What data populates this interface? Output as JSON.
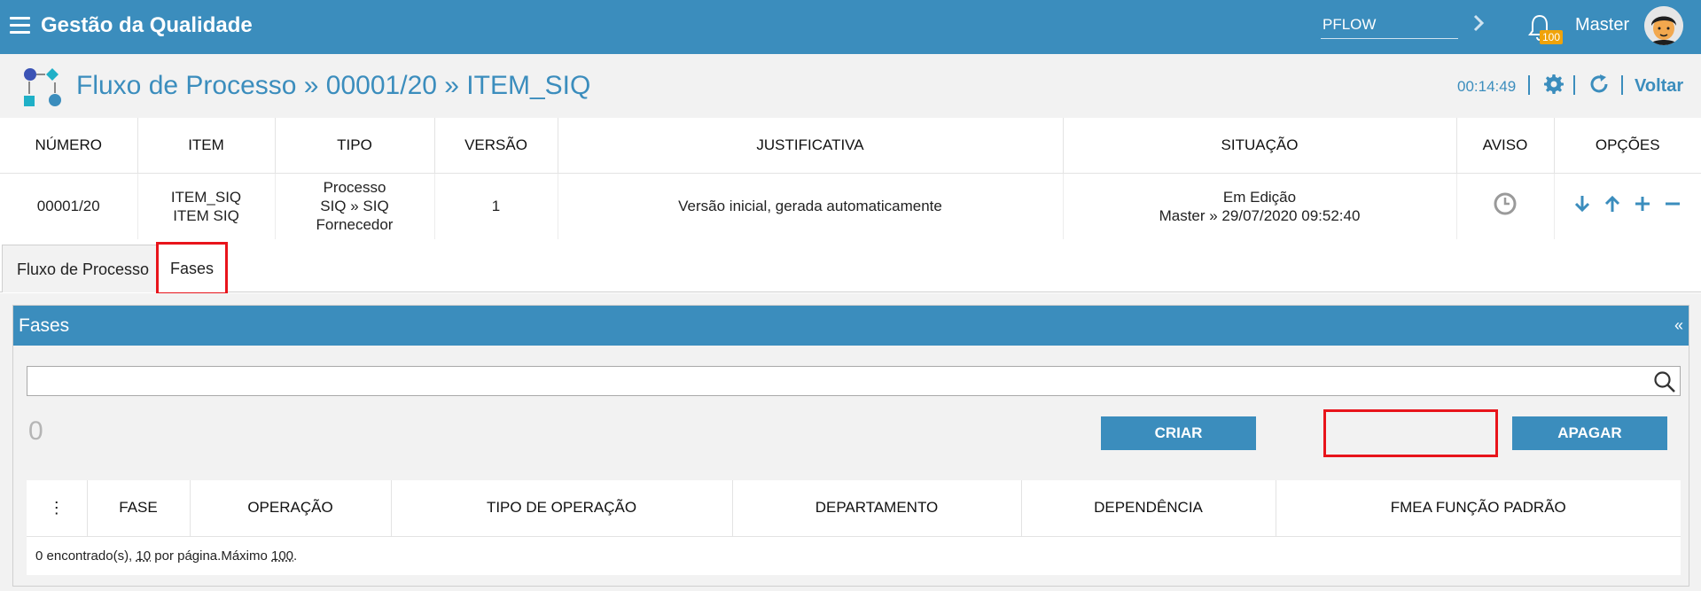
{
  "app": {
    "title": "Gestão da Qualidade",
    "module_value": "PFLOW",
    "notifications": "100",
    "user": "Master"
  },
  "header": {
    "title": "Fluxo de Processo » 00001/20 » ITEM_SIQ",
    "timer": "00:14:49",
    "back": "Voltar"
  },
  "info": {
    "columns": [
      "NÚMERO",
      "ITEM",
      "TIPO",
      "VERSÃO",
      "JUSTIFICATIVA",
      "SITUAÇÃO",
      "AVISO",
      "OPÇÕES"
    ],
    "row": {
      "numero": "00001/20",
      "item": [
        "ITEM_SIQ",
        "ITEM SIQ"
      ],
      "tipo": [
        "Processo",
        "SIQ » SIQ",
        "Fornecedor"
      ],
      "versao": "1",
      "justificativa": "Versão inicial, gerada automaticamente",
      "situacao": [
        "Em Edição",
        "Master » 29/07/2020 09:52:40"
      ]
    }
  },
  "tabs": [
    "Fluxo de Processo",
    "Fases"
  ],
  "panel": {
    "title": "Fases",
    "collapse": "«",
    "search_value": "",
    "count": "0",
    "create": "CRIAR",
    "delete": "APAGAR",
    "columns": [
      "⋮",
      "FASE",
      "OPERAÇÃO",
      "TIPO DE OPERAÇÃO",
      "DEPARTAMENTO",
      "DEPENDÊNCIA",
      "FMEA FUNÇÃO PADRÃO"
    ],
    "footer": {
      "found": "0 encontrado(s), ",
      "per_page": "10",
      "per_page_label": " por página.Máximo ",
      "max": "100",
      "end": "."
    }
  },
  "colors": {
    "primary": "#3b8dbd",
    "highlight": "#e8141b",
    "badge": "#f0a30a"
  }
}
